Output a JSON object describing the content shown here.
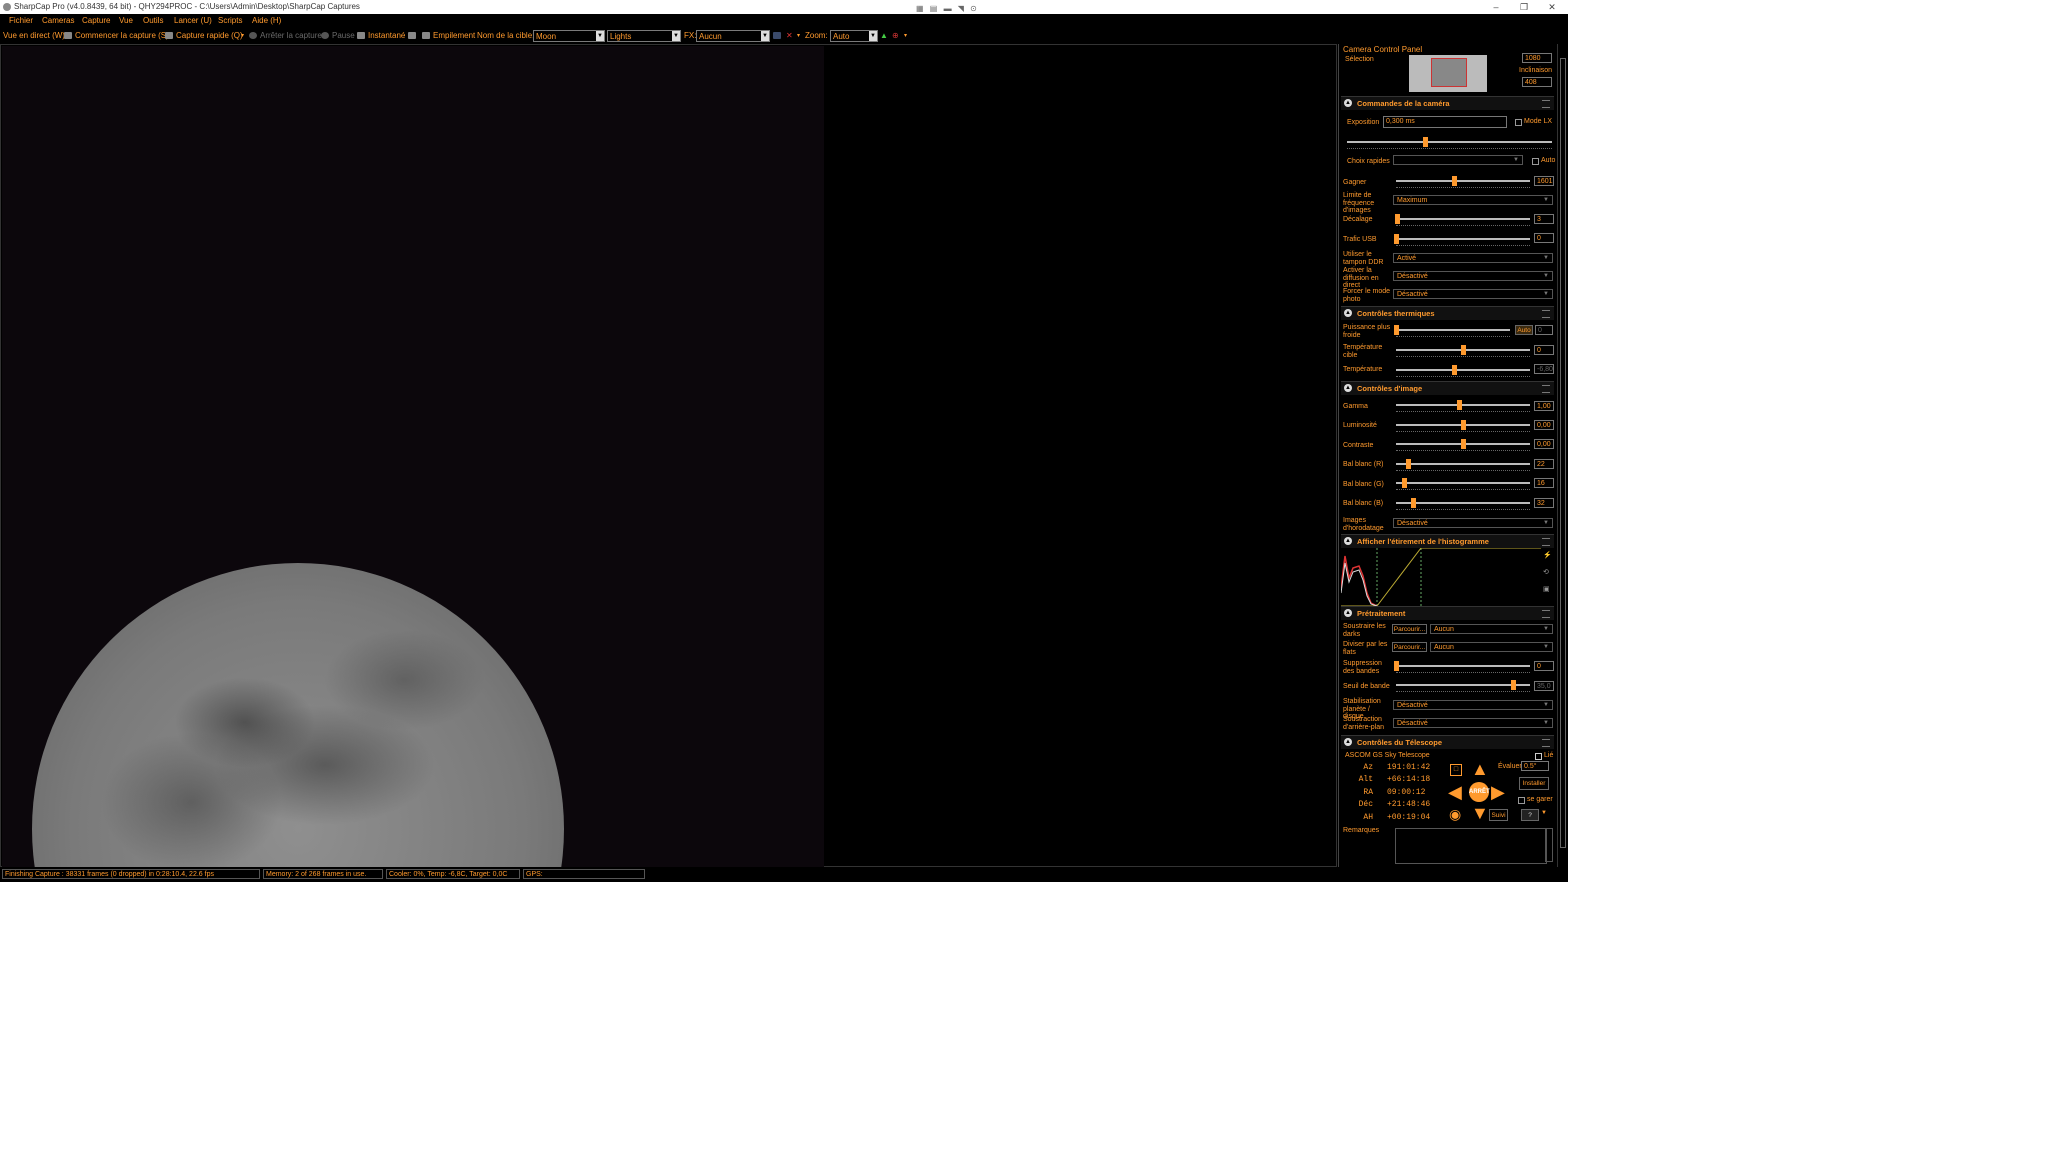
{
  "window": {
    "title": "SharpCap Pro (v4.0.8439, 64 bit) - QHY294PROC - C:\\Users\\Admin\\Desktop\\SharpCap Captures"
  },
  "menu": [
    "Fichier",
    "Cameras",
    "Capture",
    "Vue",
    "Outils",
    "Lancer (U)",
    "Scripts",
    "Aide (H)"
  ],
  "toolbar": {
    "live_view": "Vue en direct (W)",
    "start_capture": "Commencer la capture (S)",
    "quick_capture": "Capture rapide (Q)",
    "stop_capture": "Arrêter la capture",
    "pause": "Pause",
    "snapshot": "Instantané",
    "stacking": "Empilement",
    "target_label": "Nom de la cible:",
    "target_value": "Moon",
    "frame_type": "Lights",
    "fx_label": "FX:",
    "fx_value": "Aucun",
    "zoom_label": "Zoom:",
    "zoom_value": "Auto"
  },
  "panel": {
    "title": "Camera Control Panel",
    "selection_label": "Sélection",
    "selection_w": "1080",
    "inclination_label": "Inclinaison",
    "inclination_value": "408",
    "camera": {
      "title": "Commandes de la caméra",
      "exposure_label": "Exposition",
      "exposure_value": "0,300 ms",
      "lx_mode": "Mode LX",
      "quick_choice": "Choix rapides",
      "auto": "Auto",
      "gain_label": "Gagner",
      "gain_value": "1601",
      "gain_pos": 0.43,
      "framerate_label": "Limite de fréquence d'images",
      "framerate_value": "Maximum",
      "offset_label": "Décalage",
      "offset_value": "3",
      "offset_pos": 0.01,
      "usb_label": "Trafic USB",
      "usb_value": "0",
      "usb_pos": 0.0,
      "ddr_label": "Utiliser le tampon DDR",
      "ddr_value": "Activé",
      "stream_label": "Activer la diffusion en direct",
      "stream_value": "Désactivé",
      "photo_label": "Forcer le mode photo",
      "photo_value": "Désactivé"
    },
    "thermal": {
      "title": "Contrôles thermiques",
      "cooler_label": "Puissance plus froide",
      "cooler_auto": "Auto",
      "cooler_value": "0",
      "cooler_pos": 0.0,
      "target_label": "Température cible",
      "target_value": "0",
      "target_pos": 0.5,
      "temp_label": "Température",
      "temp_value": "-6,80",
      "temp_pos": 0.43
    },
    "image": {
      "title": "Contrôles d'image",
      "gamma_label": "Gamma",
      "gamma_value": "1,00",
      "gamma_pos": 0.47,
      "lum_label": "Luminosité",
      "lum_value": "0,00",
      "lum_pos": 0.5,
      "contrast_label": "Contraste",
      "contrast_value": "0,00",
      "contrast_pos": 0.5,
      "wbr_label": "Bal blanc (R)",
      "wbr_value": "22",
      "wbr_pos": 0.09,
      "wbg_label": "Bal blanc (G)",
      "wbg_value": "16",
      "wbg_pos": 0.06,
      "wbb_label": "Bal blanc (B)",
      "wbb_value": "32",
      "wbb_pos": 0.13,
      "timestamp_label": "Images d'horodatage",
      "timestamp_value": "Désactivé"
    },
    "histogram": {
      "title": "Afficher l'étirement de l'histogramme"
    },
    "preprocess": {
      "title": "Prétraitement",
      "darks_label": "Soustraire les darks",
      "darks_browse": "Parcourir...",
      "darks_value": "Aucun",
      "flats_label": "Diviser par les flats",
      "flats_browse": "Parcourir...",
      "flats_value": "Aucun",
      "banding_label": "Suppression des bandes",
      "banding_value": "0",
      "banding_pos": 0.0,
      "band_threshold_label": "Seuil de bande",
      "band_threshold_value": "35,0",
      "band_threshold_pos": 0.87,
      "stabilize_label": "Stabilisation planète / disque",
      "stabilize_value": "Désactivé",
      "bg_label": "Soustraction d'arrière-plan",
      "bg_value": "Désactivé"
    },
    "telescope": {
      "title": "Contrôles du Télescope",
      "name": "ASCOM GS Sky Telescope",
      "linked": "Lié",
      "rows": [
        {
          "k": "Az",
          "v": "191:01:42"
        },
        {
          "k": "Alt",
          "v": "+66:14:18"
        },
        {
          "k": "RA",
          "v": "09:00:12"
        },
        {
          "k": "Déc",
          "v": "+21:48:46"
        },
        {
          "k": "AH",
          "v": "+00:19:04"
        }
      ],
      "rate_label": "Évaluer",
      "rate_value": "0.5°",
      "install": "Installer",
      "park": "se garer",
      "stop": "ARRÊT",
      "track": "Suivi",
      "help": "?"
    },
    "notes_label": "Remarques"
  },
  "status": {
    "capture": "Finishing Capture : 38331 frames (0 dropped) in 0:28:10.4, 22.6 fps",
    "memory": "Memory: 2 of 268 frames in use.",
    "cooler": "Cooler: 0%, Temp: -6,8C, Target: 0,0C",
    "gps": "GPS:"
  },
  "colors": {
    "accent": "#ff9a2e",
    "background": "#000000"
  }
}
